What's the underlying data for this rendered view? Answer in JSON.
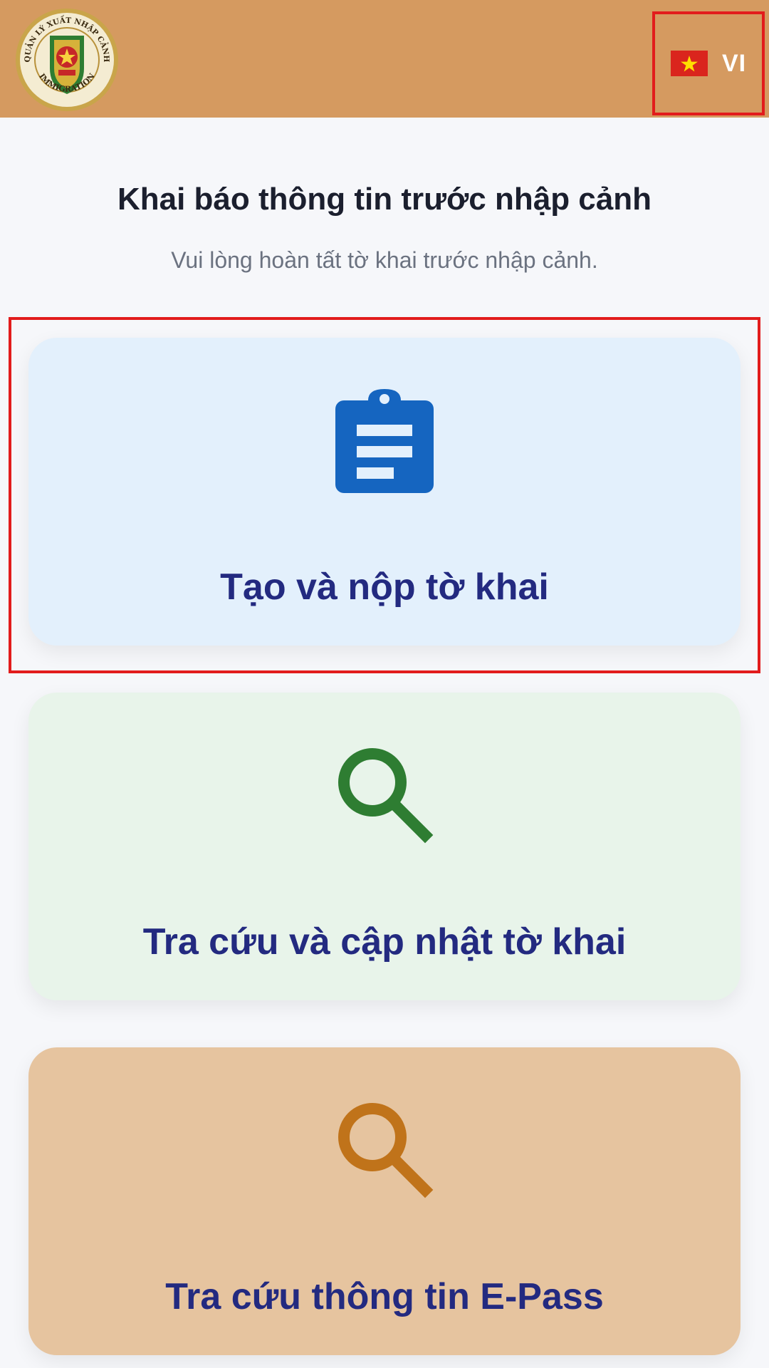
{
  "header": {
    "logo": {
      "icon": "immigration-emblem-icon",
      "arc_text": "QUẢN LÝ XUẤT NHẬP CẢNH",
      "bottom_text": "IMMIGRATION"
    },
    "language": {
      "code": "VI",
      "flag_icon": "vietnam-flag-icon"
    }
  },
  "main": {
    "title": "Khai báo thông tin trước nhập cảnh",
    "subtitle": "Vui lòng hoàn tất tờ khai trước nhập cảnh."
  },
  "cards": [
    {
      "label": "Tạo và nộp tờ khai",
      "icon": "clipboard-icon",
      "background": "#e3f0fc",
      "icon_color": "#1565c0"
    },
    {
      "label": "Tra cứu và cập nhật tờ khai",
      "icon": "search-icon",
      "background": "#e8f4ea",
      "icon_color": "#2e7d32"
    },
    {
      "label": "Tra cứu thông tin E-Pass",
      "icon": "search-icon",
      "background": "#e6c49f",
      "icon_color": "#c0731a"
    }
  ],
  "colors": {
    "header_bg": "#d59a60",
    "page_bg": "#f6f7fa",
    "label_color": "#232a80",
    "highlight": "#e21c1c"
  }
}
